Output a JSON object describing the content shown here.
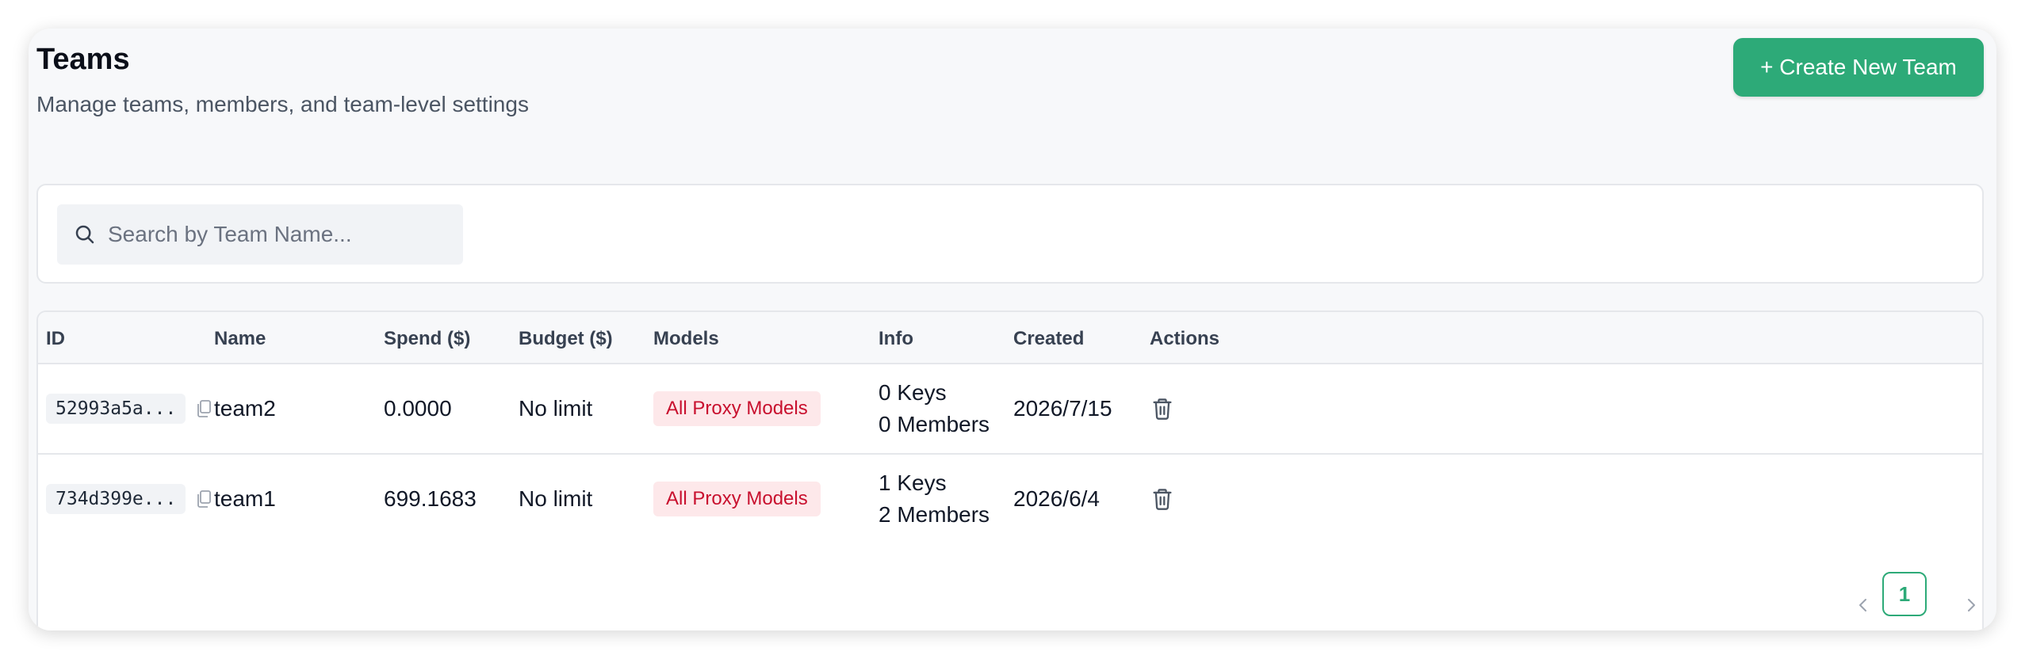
{
  "header": {
    "title": "Teams",
    "subtitle": "Manage teams, members, and team-level settings",
    "create_button": "+ Create New Team"
  },
  "search": {
    "placeholder": "Search by Team Name...",
    "value": ""
  },
  "table": {
    "columns": [
      "ID",
      "Name",
      "Spend ($)",
      "Budget ($)",
      "Models",
      "Info",
      "Created",
      "Actions"
    ],
    "rows": [
      {
        "id": "52993a5a...",
        "name": "team2",
        "spend": "0.0000",
        "budget": "No limit",
        "models": "All Proxy Models",
        "info_keys": "0 Keys",
        "info_members": "0 Members",
        "created": "2026/7/15"
      },
      {
        "id": "734d399e...",
        "name": "team1",
        "spend": "699.1683",
        "budget": "No limit",
        "models": "All Proxy Models",
        "info_keys": "1 Keys",
        "info_members": "2 Members",
        "created": "2026/6/4"
      }
    ]
  },
  "pagination": {
    "current_page": "1"
  },
  "icons": {
    "search": "search-icon",
    "copy": "copy-icon",
    "delete": "trash-icon",
    "prev": "chevron-left-icon",
    "next": "chevron-right-icon"
  },
  "colors": {
    "accent": "#2daa78",
    "model_tag_bg": "#fde8ea",
    "model_tag_text": "#c8102e"
  }
}
